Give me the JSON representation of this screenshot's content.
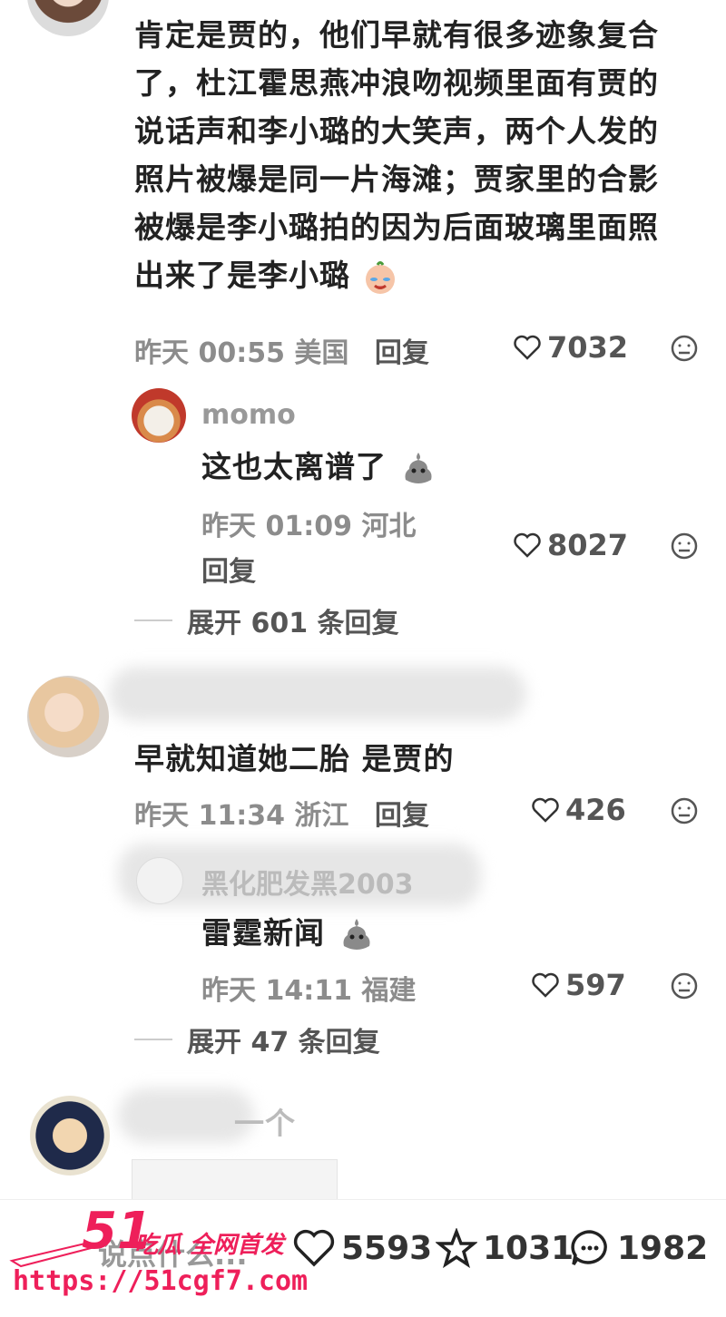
{
  "comments": [
    {
      "text_lines": [
        "肯定是贾的，他们早就有很多迹象复合",
        "了，杜江霍思燕冲浪吻视频里面有贾的",
        "说话声和李小璐的大笑声，两个人发的",
        "照片被爆是同一片海滩；贾家里的合影",
        "被爆是李小璐拍的因为后面玻璃里面照",
        "出来了是李小璐"
      ],
      "time": "昨天 00:55 美国",
      "reply_label": "回复",
      "likes": "7032"
    },
    {
      "text_lines": [
        "早就知道她二胎 是贾的"
      ],
      "time": "昨天 11:34 浙江",
      "reply_label": "回复",
      "likes": "426"
    }
  ],
  "replies": [
    {
      "username": "momo",
      "text": "这也太离谱了",
      "time": "昨天 01:09 河北",
      "reply_label": "回复",
      "likes": "8027"
    },
    {
      "username": "黑化肥发黑2003",
      "text": "雷霆新闻",
      "time": "昨天 14:11 福建",
      "likes": "597"
    }
  ],
  "expand_1": "展开 601 条回复",
  "expand_2": "展开 47 条回复",
  "partial_comment": "一个",
  "bottom": {
    "input_placeholder": "说点什么...",
    "likes": "5593",
    "favorites": "1031",
    "comments": "1982"
  },
  "watermark": {
    "brand": "51",
    "slogan": "吃瓜 全网首发",
    "url": "https://51cgf7.com"
  },
  "colors": {
    "accent": "#ee1f5a",
    "meta_gray": "#8c8c8c"
  }
}
